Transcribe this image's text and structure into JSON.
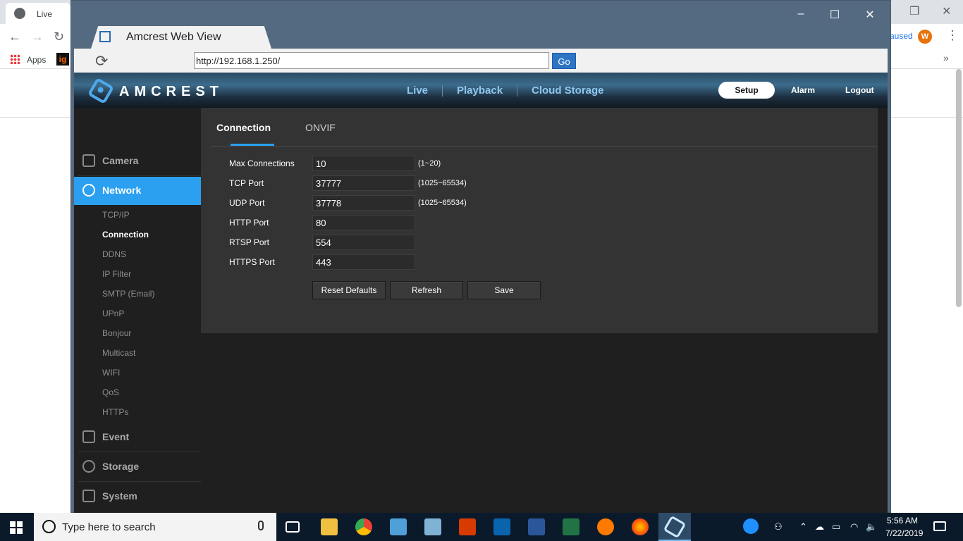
{
  "background_browser": {
    "tab_title": "Live",
    "bookmarks": {
      "apps_label": "Apps",
      "ig_label": "ig"
    },
    "paused_label": "aused",
    "avatar_letter": "W"
  },
  "app_window": {
    "tab_title": "Amcrest Web View",
    "url": "http://192.168.1.250/",
    "go_label": "Go"
  },
  "amcrest": {
    "logo": "AMCREST",
    "nav": [
      "Live",
      "Playback",
      "Cloud Storage"
    ],
    "setup_label": "Setup",
    "alarm_label": "Alarm",
    "logout_label": "Logout",
    "accent": "#2ba0f0"
  },
  "sidebar": {
    "camera": "Camera",
    "network": "Network",
    "sub_items": [
      "TCP/IP",
      "Connection",
      "DDNS",
      "IP Filter",
      "SMTP (Email)",
      "UPnP",
      "Bonjour",
      "Multicast",
      "WIFI",
      "QoS",
      "HTTPs"
    ],
    "active_sub": "Connection",
    "event": "Event",
    "storage": "Storage",
    "system": "System"
  },
  "tabs": {
    "connection": "Connection",
    "onvif": "ONVIF"
  },
  "form": {
    "rows": [
      {
        "label": "Max Connections",
        "value": "10",
        "range": "(1~20)"
      },
      {
        "label": "TCP Port",
        "value": "37777",
        "range": "(1025~65534)"
      },
      {
        "label": "UDP Port",
        "value": "37778",
        "range": "(1025~65534)"
      },
      {
        "label": "HTTP Port",
        "value": "80",
        "range": ""
      },
      {
        "label": "RTSP Port",
        "value": "554",
        "range": ""
      },
      {
        "label": "HTTPS Port",
        "value": "443",
        "range": ""
      }
    ],
    "buttons": {
      "reset": "Reset Defaults",
      "refresh": "Refresh",
      "save": "Save"
    }
  },
  "taskbar": {
    "search_placeholder": "Type here to search",
    "time": "5:56 AM",
    "date": "7/22/2019"
  }
}
